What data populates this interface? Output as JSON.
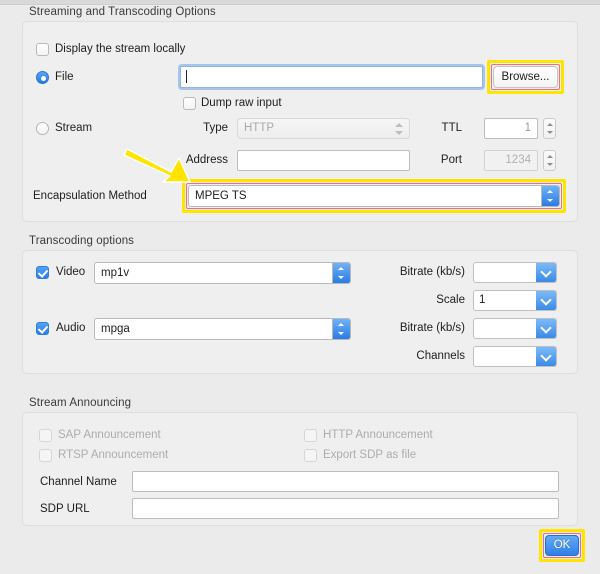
{
  "window": {
    "title": "Streaming and Transcoding Options"
  },
  "colors": {
    "highlight": "#ffe400",
    "highlight_inner": "#f26d7d",
    "accent_blue": "#2f7fe6",
    "panel_bg": "#efefef",
    "window_bg": "#ebebeb"
  },
  "streaming": {
    "group_title": "Streaming and Transcoding Options",
    "display_locally": {
      "label": "Display the stream locally",
      "checked": false
    },
    "file": {
      "label": "File",
      "selected": true,
      "value": "",
      "placeholder": ""
    },
    "browse": {
      "label": "Browse...",
      "highlighted": true
    },
    "dump_raw_input": {
      "label": "Dump raw input",
      "checked": false
    },
    "stream": {
      "label": "Stream",
      "selected": false
    },
    "type": {
      "label": "Type",
      "value": "HTTP",
      "disabled": true
    },
    "ttl": {
      "label": "TTL",
      "value": "1"
    },
    "address": {
      "label": "Address",
      "value": ""
    },
    "port": {
      "label": "Port",
      "value": "1234",
      "disabled": true
    },
    "encapsulation": {
      "label": "Encapsulation Method",
      "value": "MPEG TS",
      "highlighted": true
    }
  },
  "transcoding": {
    "group_title": "Transcoding options",
    "video": {
      "label": "Video",
      "checked": true,
      "codec": "mp1v"
    },
    "audio": {
      "label": "Audio",
      "checked": true,
      "codec": "mpga"
    },
    "video_bitrate": {
      "label": "Bitrate (kb/s)",
      "value": ""
    },
    "scale": {
      "label": "Scale",
      "value": "1"
    },
    "audio_bitrate": {
      "label": "Bitrate (kb/s)",
      "value": ""
    },
    "channels": {
      "label": "Channels",
      "value": ""
    }
  },
  "announcing": {
    "group_title": "Stream Announcing",
    "sap": {
      "label": "SAP Announcement",
      "checked": false,
      "disabled": true
    },
    "http": {
      "label": "HTTP Announcement",
      "checked": false,
      "disabled": true
    },
    "rtsp": {
      "label": "RTSP Announcement",
      "checked": false,
      "disabled": true
    },
    "export_sdp": {
      "label": "Export SDP as file",
      "checked": false,
      "disabled": true
    },
    "channel_name": {
      "label": "Channel Name",
      "value": ""
    },
    "sdp_url": {
      "label": "SDP URL",
      "value": ""
    }
  },
  "footer": {
    "ok": {
      "label": "OK",
      "highlighted": true,
      "default": true
    }
  }
}
